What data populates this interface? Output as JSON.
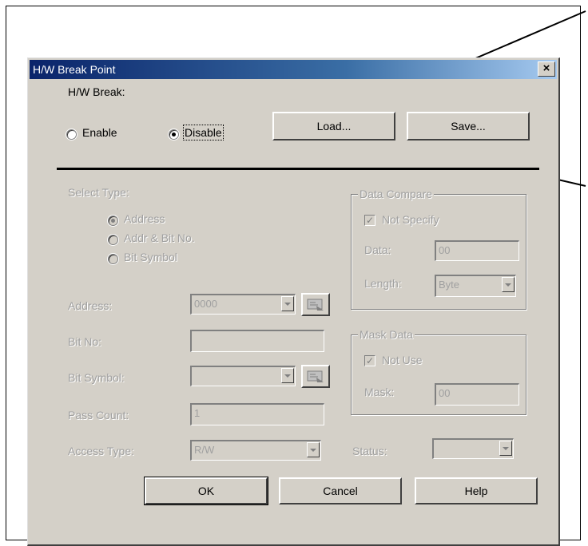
{
  "dialog": {
    "title": "H/W Break Point",
    "close_glyph": "×"
  },
  "hw_break": {
    "label": "H/W Break:",
    "options": [
      "Enable",
      "Disable"
    ],
    "selected": "Disable"
  },
  "buttons": {
    "load": "Load...",
    "save": "Save...",
    "ok": "OK",
    "cancel": "Cancel",
    "help": "Help"
  },
  "select_type": {
    "label": "Select Type:",
    "options": [
      "Address",
      "Addr & Bit No.",
      "Bit Symbol"
    ],
    "selected": "Address"
  },
  "fields": {
    "address_label": "Address:",
    "address_value": "0000",
    "bitno_label": "Bit No:",
    "bitno_value": "",
    "bitsymbol_label": "Bit Symbol:",
    "bitsymbol_value": "",
    "passcount_label": "Pass Count:",
    "passcount_value": "1",
    "accesstype_label": "Access Type:",
    "accesstype_value": "R/W",
    "status_label": "Status:",
    "status_value": ""
  },
  "data_compare": {
    "title": "Data Compare",
    "not_specify_label": "Not Specify",
    "not_specify_checked": true,
    "data_label": "Data:",
    "data_value": "00",
    "length_label": "Length:",
    "length_value": "Byte"
  },
  "mask_data": {
    "title": "Mask Data",
    "not_use_label": "Not Use",
    "not_use_checked": true,
    "mask_label": "Mask:",
    "mask_value": "00"
  },
  "icons": {
    "browse": "browse-symbol-icon",
    "dropdown": "chevron-down-icon",
    "check": "checkmark-icon"
  },
  "colors": {
    "dialog_bg": "#d4d0c8",
    "title_start": "#0a246a",
    "title_end": "#a6caf0",
    "disabled_text": "#a0a0a0"
  }
}
